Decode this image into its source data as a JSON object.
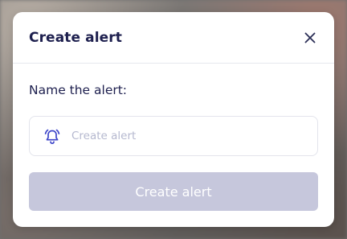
{
  "modal": {
    "title": "Create alert",
    "close_icon": "close-icon"
  },
  "form": {
    "label": "Name the alert:",
    "input": {
      "value": "",
      "placeholder": "Create alert",
      "icon": "bell-ringing-icon"
    },
    "submit_label": "Create alert",
    "submit_disabled": true
  },
  "colors": {
    "title_text": "#1d1f4e",
    "accent_icon": "#3e46c9",
    "placeholder_text": "#b5b8cf",
    "disabled_button_bg": "#c6c7dc",
    "disabled_button_text": "#ffffff"
  }
}
